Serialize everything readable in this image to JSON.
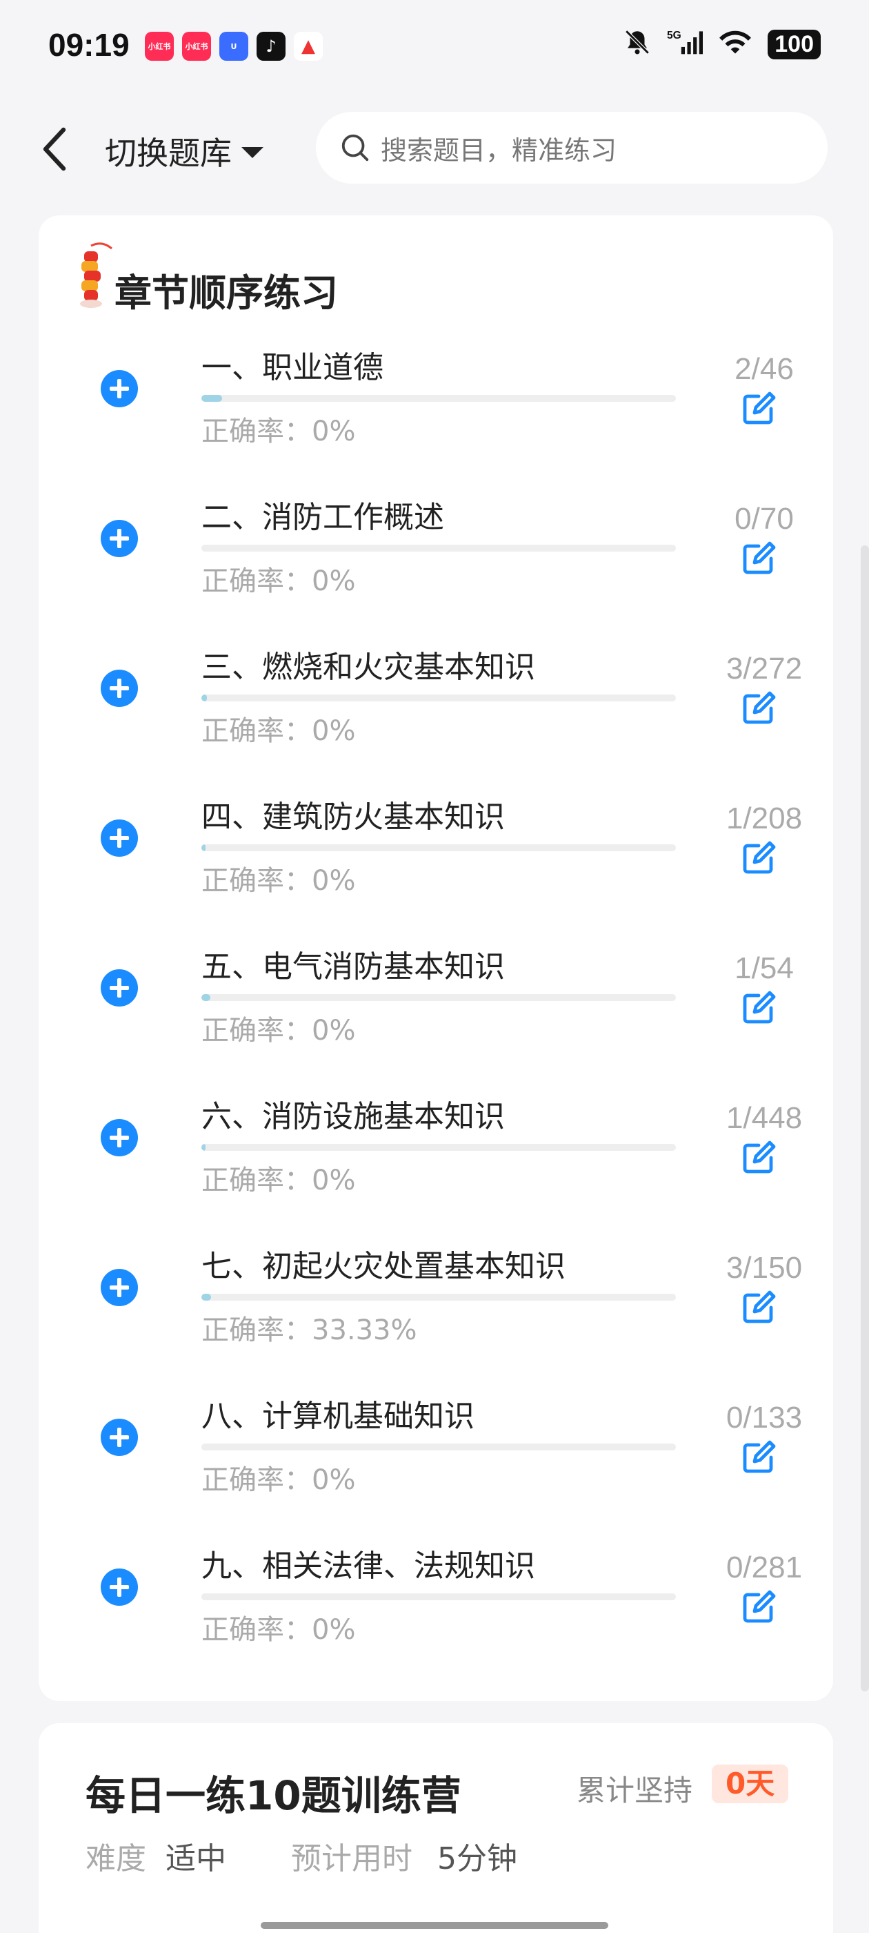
{
  "status_bar": {
    "time": "09:19",
    "app_icons": [
      {
        "name": "xiaohongshu-icon",
        "label": "小红书",
        "color": "#ff2d55"
      },
      {
        "name": "xiaohongshu-icon-2",
        "label": "小红书",
        "color": "#ff2d55"
      },
      {
        "name": "blue-app-icon",
        "label": "U",
        "color": "#3a6cff"
      },
      {
        "name": "tiktok-icon",
        "label": "♪",
        "color": "#111111"
      },
      {
        "name": "red-triangle-app-icon",
        "label": "▲",
        "color": "#ffffff"
      }
    ],
    "network": "5G",
    "battery": "100"
  },
  "header": {
    "switch_label": "切换题库",
    "search_placeholder": "搜索题目，精准练习"
  },
  "section": {
    "title": "章节顺序练习",
    "chapters": [
      {
        "title": "一、职业道德",
        "accuracy": "正确率：0%",
        "count": "2/46",
        "progress": 0.0435
      },
      {
        "title": "二、消防工作概述",
        "accuracy": "正确率：0%",
        "count": "0/70",
        "progress": 0
      },
      {
        "title": "三、燃烧和火灾基本知识",
        "accuracy": "正确率：0%",
        "count": "3/272",
        "progress": 0.011
      },
      {
        "title": "四、建筑防火基本知识",
        "accuracy": "正确率：0%",
        "count": "1/208",
        "progress": 0.0048
      },
      {
        "title": "五、电气消防基本知识",
        "accuracy": "正确率：0%",
        "count": "1/54",
        "progress": 0.0185
      },
      {
        "title": "六、消防设施基本知识",
        "accuracy": "正确率：0%",
        "count": "1/448",
        "progress": 0.0022
      },
      {
        "title": "七、初起火灾处置基本知识",
        "accuracy": "正确率：33.33%",
        "count": "3/150",
        "progress": 0.02
      },
      {
        "title": "八、计算机基础知识",
        "accuracy": "正确率：0%",
        "count": "0/133",
        "progress": 0
      },
      {
        "title": "九、相关法律、法规知识",
        "accuracy": "正确率：0%",
        "count": "0/281",
        "progress": 0
      }
    ]
  },
  "camp": {
    "title": "每日一练10题训练营",
    "persist_label": "累计坚持",
    "persist_value": "0天",
    "difficulty_label": "难度",
    "difficulty_value": "适中",
    "time_label": "预计用时",
    "time_value": "5分钟"
  },
  "colors": {
    "accent_blue": "#1a8cff",
    "progress_fill": "#9fd3e6",
    "badge_orange": "#ff5a2a"
  }
}
